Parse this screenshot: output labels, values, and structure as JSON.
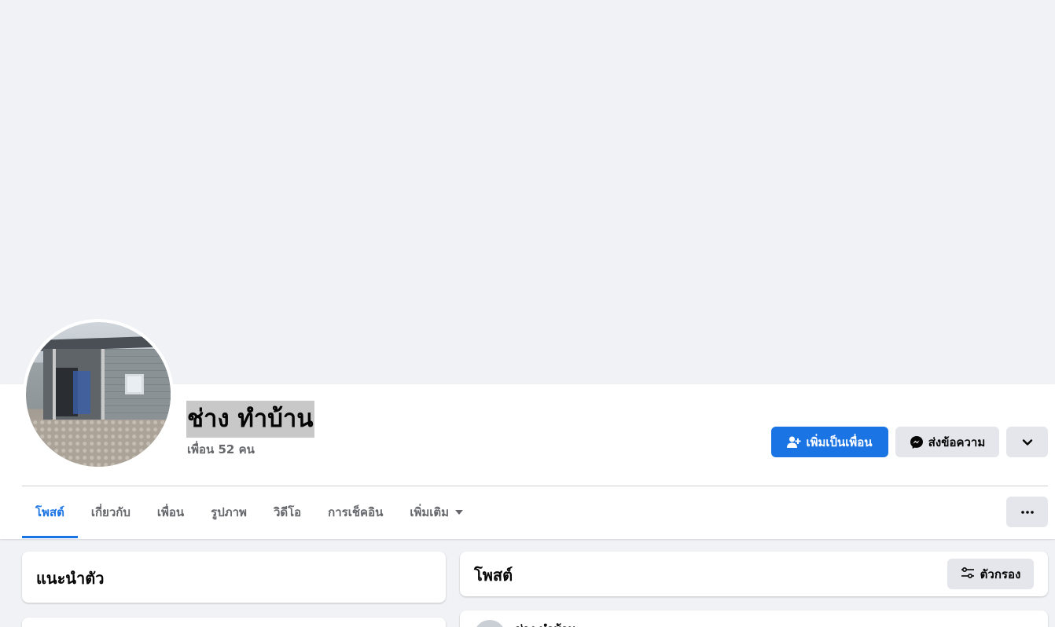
{
  "profile": {
    "name": "ช่าง ทำบ้าน",
    "friends": "เพื่อน 52 คน"
  },
  "actions": {
    "add_friend": "เพิ่มเป็นเพื่อน",
    "message": "ส่งข้อความ"
  },
  "tabs": [
    {
      "label": "โพสต์",
      "active": true
    },
    {
      "label": "เกี่ยวกับ",
      "active": false
    },
    {
      "label": "เพื่อน",
      "active": false
    },
    {
      "label": "รูปภาพ",
      "active": false
    },
    {
      "label": "วิดีโอ",
      "active": false
    },
    {
      "label": "การเช็คอิน",
      "active": false
    },
    {
      "label": "เพิ่มเติม",
      "active": false
    }
  ],
  "intro": {
    "title": "แนะนำตัว"
  },
  "posts": {
    "title": "โพสต์",
    "filter_label": "ตัวกรอง",
    "first_author": "ช่าง ทำบ้าน"
  },
  "colors": {
    "accent": "#1b74e4",
    "background": "#f0f2f5",
    "secondary_button": "#e4e6eb",
    "muted_text": "#65676b"
  }
}
